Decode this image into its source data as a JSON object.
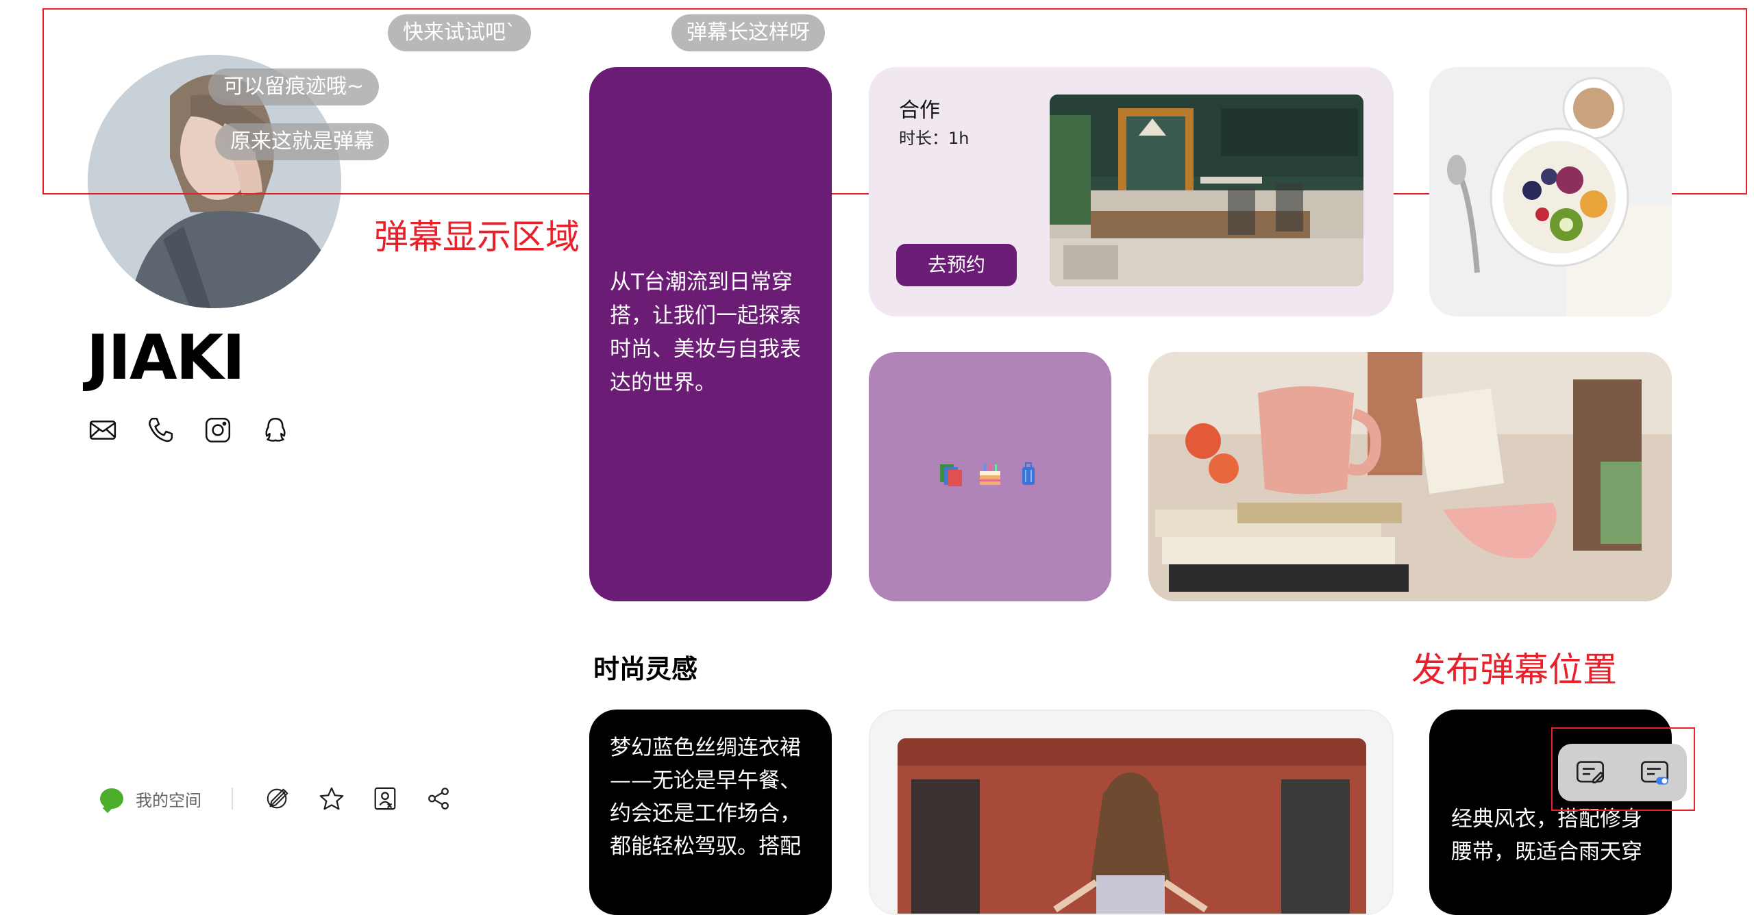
{
  "danmaku": {
    "items": [
      "快来试试吧`",
      "弹幕长这样呀",
      "可以留痕迹哦~",
      "原来这就是弹幕"
    ],
    "display_area_label": "弹幕显示区域",
    "publish_label": "发布弹幕位置",
    "annotation_color": "#e8202a"
  },
  "profile": {
    "name": "JIAKI",
    "contact_icons": [
      "mail-icon",
      "phone-icon",
      "instagram-icon",
      "qq-icon"
    ]
  },
  "cards": {
    "intro_text": "从T台潮流到日常穿搭，让我们一起探索时尚、美妆与自我表达的世界。",
    "coop_title": "合作",
    "coop_duration": "时长：1h",
    "coop_button": "去预约",
    "emoji_icons": [
      "books-icon",
      "cake-icon",
      "luggage-icon"
    ]
  },
  "section": {
    "title": "时尚灵感",
    "card1_text": "梦幻蓝色丝绸连衣裙——无论是早午餐、约会还是工作场合，都能轻松驾驭。搭配",
    "card3_text": "经典风衣，搭配修身腰带，既适合雨天穿"
  },
  "bottom_bar": {
    "space_label": "我的空间",
    "icons": [
      "no-edit-icon",
      "star-icon",
      "contact-card-icon",
      "share-icon"
    ]
  },
  "colors": {
    "purple": "#6b1d76",
    "lilac": "#b084b8",
    "coop_bg": "#f0e7f1"
  }
}
